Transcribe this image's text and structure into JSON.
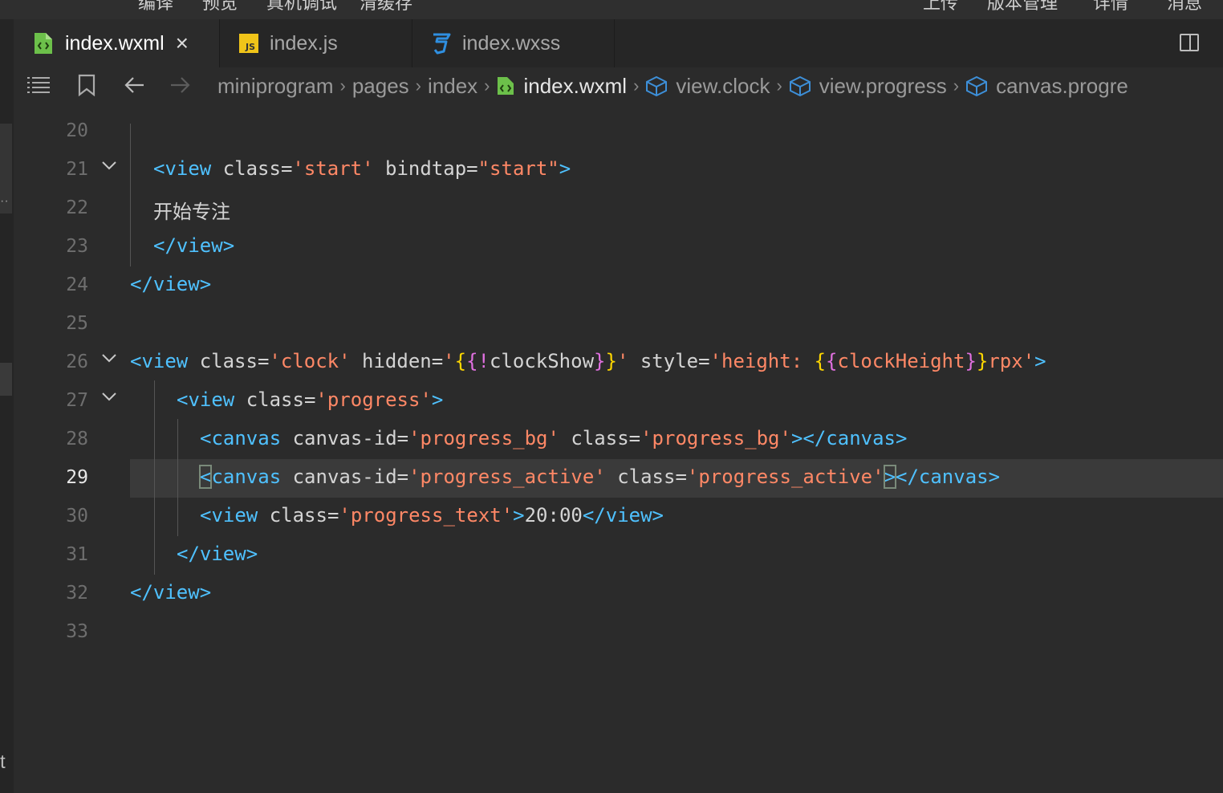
{
  "topbar": {
    "items": [
      "编译",
      "预览",
      "真机调试",
      "清缓存",
      "上传",
      "版本管理",
      "详情",
      "消息"
    ]
  },
  "tabs": [
    {
      "label": "index.wxml",
      "icon": "wxml-file-icon",
      "active": true,
      "close": "×"
    },
    {
      "label": "index.js",
      "icon": "js-file-icon",
      "active": false
    },
    {
      "label": "index.wxss",
      "icon": "css-file-icon",
      "active": false
    }
  ],
  "breadcrumb": {
    "segments": [
      "miniprogram",
      "pages",
      "index",
      "index.wxml",
      "view.clock",
      "view.progress",
      "canvas.progre"
    ]
  },
  "editor": {
    "current_line": 29,
    "lines": [
      {
        "no": "20",
        "text": ""
      },
      {
        "no": "21",
        "text": "<view class='start' bindtap=\"start\">"
      },
      {
        "no": "22",
        "text": "开始专注"
      },
      {
        "no": "23",
        "text": "</view>"
      },
      {
        "no": "24",
        "text": "</view>"
      },
      {
        "no": "25",
        "text": ""
      },
      {
        "no": "26",
        "text": "<view class='clock' hidden='{{!clockShow}}' style='height: {{clockHeight}}rpx'>"
      },
      {
        "no": "27",
        "text": "<view class='progress'>"
      },
      {
        "no": "28",
        "text": "<canvas canvas-id='progress_bg' class='progress_bg'></canvas>"
      },
      {
        "no": "29",
        "text": "<canvas canvas-id='progress_active' class='progress_active'></canvas>"
      },
      {
        "no": "30",
        "text": "<view class='progress_text'>20:00</view>"
      },
      {
        "no": "31",
        "text": "</view>"
      },
      {
        "no": "32",
        "text": "</view>"
      },
      {
        "no": "33",
        "text": ""
      }
    ]
  },
  "colors": {
    "tag": "#4fc1ff",
    "string": "#ff8866",
    "mustache": "#ffd700",
    "background": "#2b2b2b"
  }
}
